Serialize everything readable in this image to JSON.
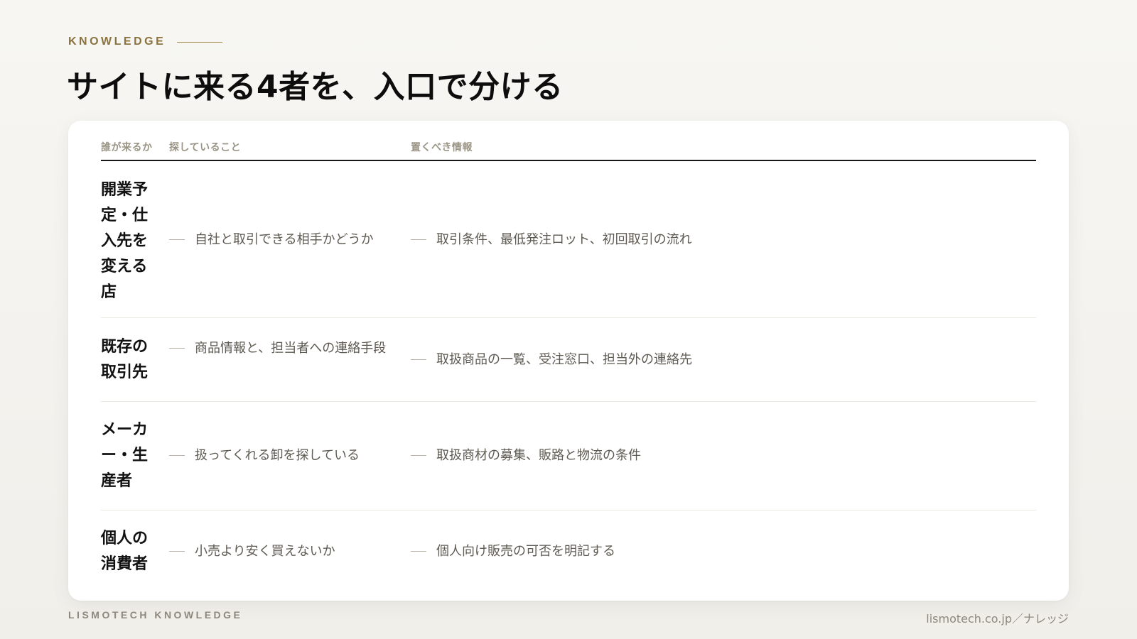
{
  "eyebrow": "KNOWLEDGE",
  "title": "サイトに来る4者を、入口で分ける",
  "table": {
    "headers": {
      "who": "誰が来るか",
      "seek": "探していること",
      "info": "置くべき情報"
    },
    "rows": [
      {
        "who": "開業予定・仕入先を変える店",
        "seek": "自社と取引できる相手かどうか",
        "info": "取引条件、最低発注ロット、初回取引の流れ"
      },
      {
        "who": "既存の取引先",
        "seek": "商品情報と、担当者への連絡手段",
        "info": "取扱商品の一覧、受注窓口、担当外の連絡先"
      },
      {
        "who": "メーカー・生産者",
        "seek": "扱ってくれる卸を探している",
        "info": "取扱商材の募集、販路と物流の条件"
      },
      {
        "who": "個人の消費者",
        "seek": "小売より安く買えないか",
        "info": "個人向け販売の可否を明記する"
      }
    ]
  },
  "footer": {
    "brand": "LISMOTECH KNOWLEDGE",
    "url": "lismotech.co.jp／ナレッジ"
  }
}
